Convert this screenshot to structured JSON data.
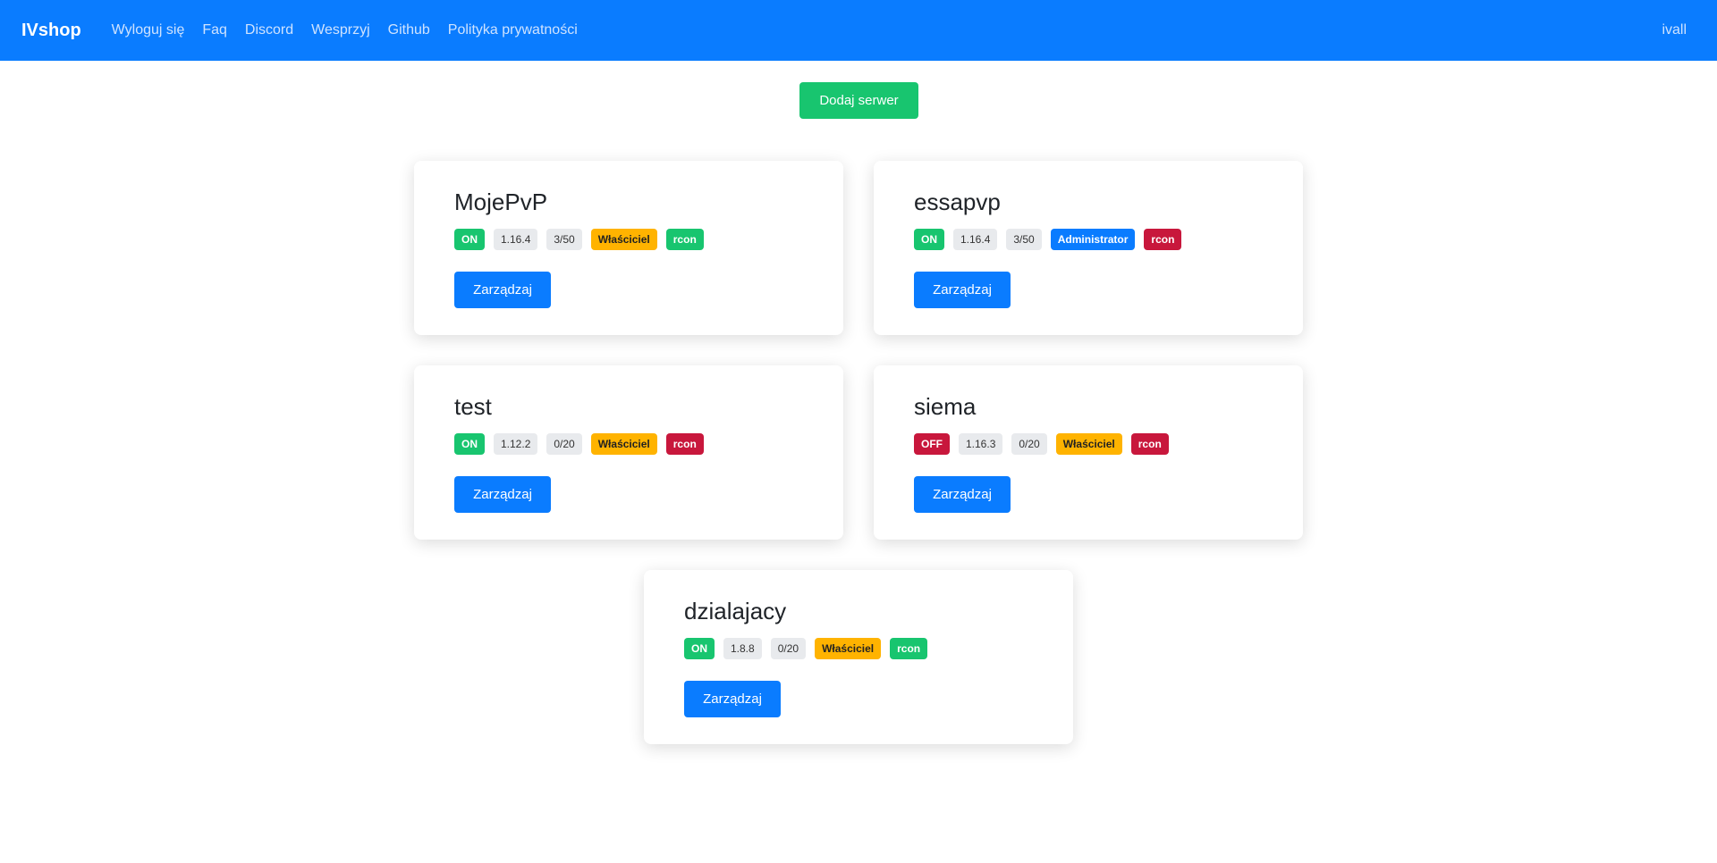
{
  "navbar": {
    "brand": "IVshop",
    "links": [
      "Wyloguj się",
      "Faq",
      "Discord",
      "Wesprzyj",
      "Github",
      "Polityka prywatności"
    ],
    "user": "ivall"
  },
  "add_server_label": "Dodaj serwer",
  "manage_label": "Zarządzaj",
  "servers": [
    {
      "name": "MojePvP",
      "status": "ON",
      "version": "1.16.4",
      "players": "3/50",
      "role": "Właściciel",
      "rcon": "rcon"
    },
    {
      "name": "essapvp",
      "status": "ON",
      "version": "1.16.4",
      "players": "3/50",
      "role": "Administrator",
      "rcon": "rcon"
    },
    {
      "name": "test",
      "status": "ON",
      "version": "1.12.2",
      "players": "0/20",
      "role": "Właściciel",
      "rcon": "rcon"
    },
    {
      "name": "siema",
      "status": "OFF",
      "version": "1.16.3",
      "players": "0/20",
      "role": "Właściciel",
      "rcon": "rcon"
    },
    {
      "name": "dzialajacy",
      "status": "ON",
      "version": "1.8.8",
      "players": "0/20",
      "role": "Właściciel",
      "rcon": "rcon"
    }
  ],
  "colors": {
    "primary": "#0a7cff",
    "success": "#18c56f",
    "danger": "#c8173c",
    "warning": "#ffb300"
  }
}
